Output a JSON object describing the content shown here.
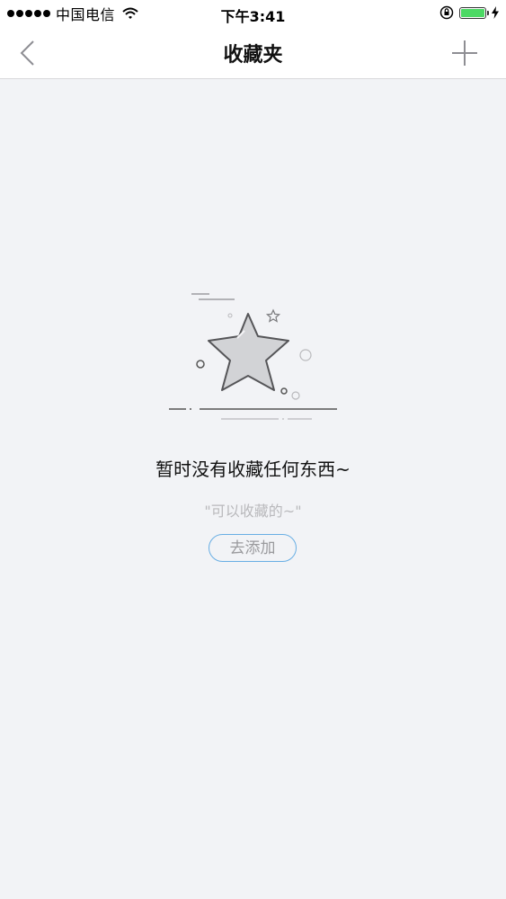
{
  "status_bar": {
    "carrier": "中国电信",
    "time": "下午3:41",
    "battery_color": "#4cd964"
  },
  "nav": {
    "title": "收藏夹",
    "back_icon": "chevron-left-icon",
    "add_icon": "plus-icon"
  },
  "empty_state": {
    "illustration_icon": "star-icon",
    "title": "暂时没有收藏任何东西~",
    "hint": "\"可以收藏的~\"",
    "button_label": "去添加",
    "button_border_color": "#68aee4"
  }
}
